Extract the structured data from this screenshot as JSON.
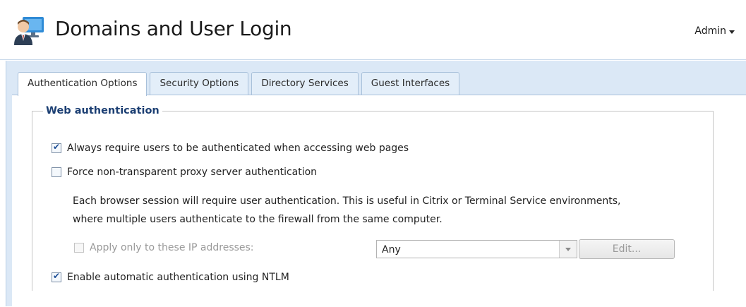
{
  "app": {
    "title": "Domains and User Login",
    "user_menu": "Admin",
    "icon": "user-monitor-icon"
  },
  "tabs": [
    {
      "label": "Authentication Options",
      "active": true
    },
    {
      "label": "Security Options",
      "active": false
    },
    {
      "label": "Directory Services",
      "active": false
    },
    {
      "label": "Guest Interfaces",
      "active": false
    }
  ],
  "web_auth": {
    "legend": "Web authentication",
    "always_require": {
      "label": "Always require users to be authenticated when accessing web pages",
      "checked": true
    },
    "force_proxy": {
      "label": "Force non-transparent proxy server authentication",
      "checked": false
    },
    "description_line1": "Each browser session will require user authentication. This is useful in Citrix or Terminal Service environments,",
    "description_line2": "where multiple users authenticate to the firewall from the same computer.",
    "apply_ip": {
      "label": "Apply only to these IP addresses:",
      "checked": false,
      "enabled": false
    },
    "ip_select_value": "Any",
    "edit_button": "Edit...",
    "ntlm": {
      "label": "Enable automatic authentication using NTLM",
      "checked": true
    }
  },
  "colors": {
    "accent": "#1c3f73",
    "background": "#dbe8f6",
    "tab_border": "#a8c0da"
  }
}
